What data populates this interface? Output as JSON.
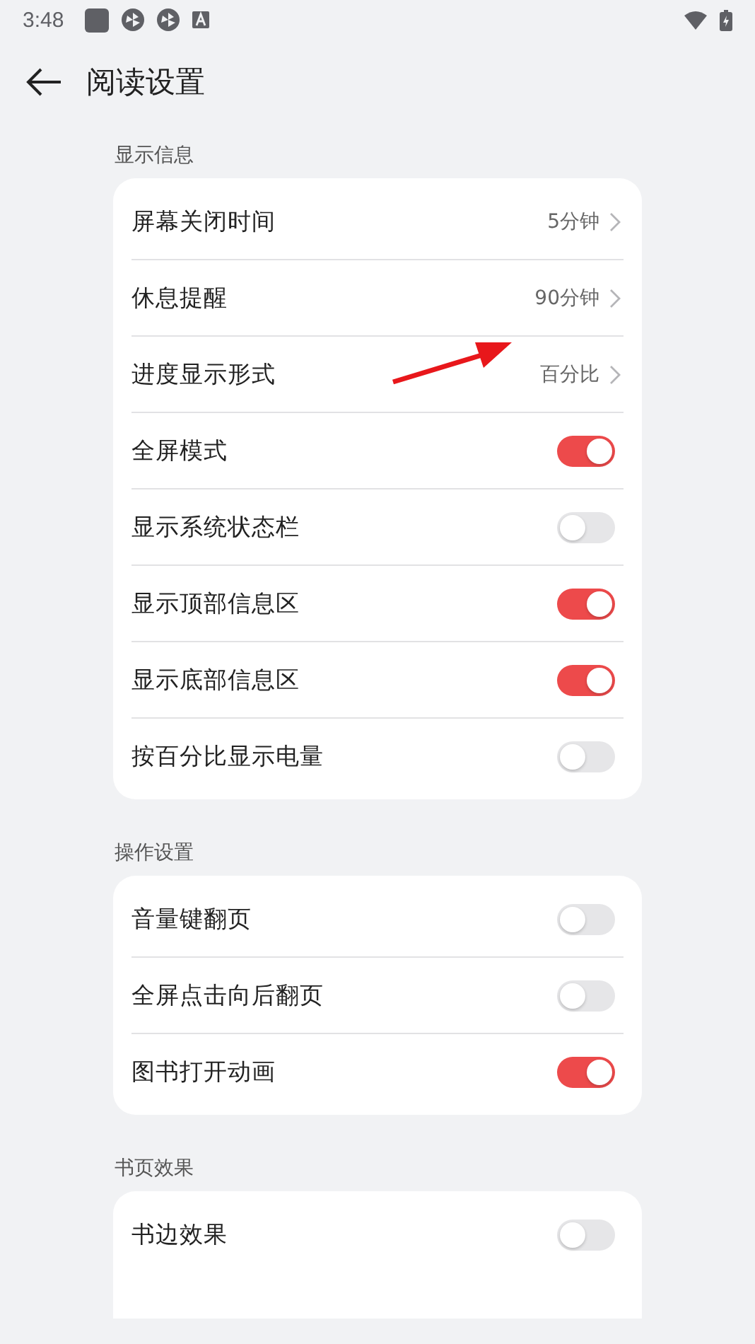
{
  "status_bar": {
    "time": "3:48"
  },
  "header": {
    "title": "阅读设置"
  },
  "sections": [
    {
      "title": "显示信息",
      "items": [
        {
          "kind": "value",
          "label": "屏幕关闭时间",
          "value": "5分钟"
        },
        {
          "kind": "value",
          "label": "休息提醒",
          "value": "90分钟"
        },
        {
          "kind": "value",
          "label": "进度显示形式",
          "value": "百分比"
        },
        {
          "kind": "toggle",
          "label": "全屏模式",
          "on": true
        },
        {
          "kind": "toggle",
          "label": "显示系统状态栏",
          "on": false
        },
        {
          "kind": "toggle",
          "label": "显示顶部信息区",
          "on": true
        },
        {
          "kind": "toggle",
          "label": "显示底部信息区",
          "on": true
        },
        {
          "kind": "toggle",
          "label": "按百分比显示电量",
          "on": false
        }
      ]
    },
    {
      "title": "操作设置",
      "items": [
        {
          "kind": "toggle",
          "label": "音量键翻页",
          "on": false
        },
        {
          "kind": "toggle",
          "label": "全屏点击向后翻页",
          "on": false
        },
        {
          "kind": "toggle",
          "label": "图书打开动画",
          "on": true
        }
      ]
    },
    {
      "title": "书页效果",
      "items": [
        {
          "kind": "toggle",
          "label": "书边效果",
          "on": false
        }
      ]
    }
  ]
}
